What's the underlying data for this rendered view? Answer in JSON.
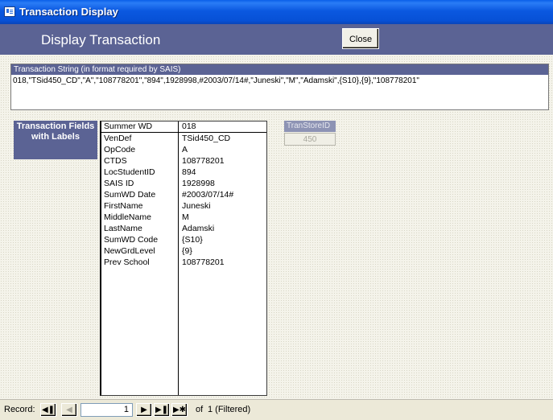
{
  "window": {
    "title": "Transaction Display",
    "icon": "form-icon"
  },
  "header": {
    "title": "Display Transaction",
    "close_label": "Close"
  },
  "transaction_string": {
    "label": "Transaction String (in format required by SAIS)",
    "value": "018,\"TSid450_CD\",\"A\",\"108778201\",\"894\",1928998,#2003/07/14#,\"Juneski\",\"M\",\"Adamski\",{S10},{9},\"108778201\""
  },
  "fields_panel": {
    "label": "Transaction Fields with Labels",
    "rows": [
      {
        "label": "Summer WD",
        "value": "018"
      },
      {
        "label": "VenDef",
        "value": "TSid450_CD"
      },
      {
        "label": "OpCode",
        "value": "A"
      },
      {
        "label": "CTDS",
        "value": "108778201"
      },
      {
        "label": "LocStudentID",
        "value": "894"
      },
      {
        "label": "SAIS ID",
        "value": "1928998"
      },
      {
        "label": "SumWD Date",
        "value": "#2003/07/14#"
      },
      {
        "label": "FirstName",
        "value": "Juneski"
      },
      {
        "label": "MiddleName",
        "value": "M"
      },
      {
        "label": "LastName",
        "value": "Adamski"
      },
      {
        "label": "SumWD Code",
        "value": "{S10}"
      },
      {
        "label": "NewGrdLevel",
        "value": "{9}"
      },
      {
        "label": "Prev School",
        "value": "108778201"
      }
    ]
  },
  "tran_store": {
    "label": "TranStoreID",
    "value": "450"
  },
  "record_nav": {
    "label": "Record:",
    "current": "1",
    "of_text": "of",
    "total_text": "1 (Filtered)",
    "buttons": {
      "first": "first-record-icon",
      "prev": "previous-record-icon",
      "next": "next-record-icon",
      "last": "last-record-icon",
      "new": "new-record-icon"
    }
  },
  "colors": {
    "title_bar": "#0a5fe8",
    "header_bg": "#5b6394",
    "label_bg": "#5b6394",
    "disabled_label_bg": "#8d93b4"
  }
}
